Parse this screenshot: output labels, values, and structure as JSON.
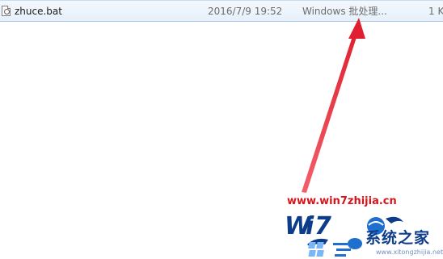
{
  "file_row": {
    "icon": "batch-file-icon",
    "name": "zhuce.bat",
    "date_modified": "2016/7/9 19:52",
    "type": "Windows 批处理...",
    "size": "1 K"
  },
  "annotation": {
    "arrow_color": "#e8303a"
  },
  "watermark": {
    "url": "www.win7zhijia.cn",
    "brand": "系统之家",
    "small_url": "www.xitongzhijia.net",
    "url_color": "#d4161c",
    "brand_color": "#0d3d8a"
  }
}
